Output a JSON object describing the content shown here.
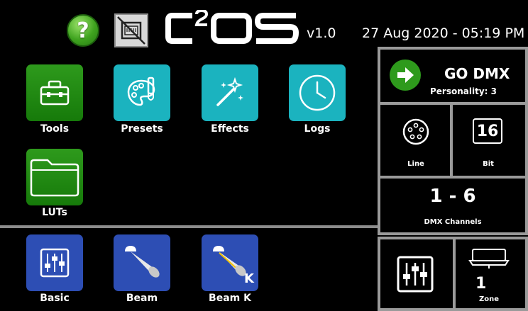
{
  "header": {
    "help_symbol": "?",
    "logo_text": "C2OS",
    "version": "v1.0",
    "datetime": "27 Aug 2020 - 05:19 PM"
  },
  "apps": {
    "tools": "Tools",
    "presets": "Presets",
    "effects": "Effects",
    "logs": "Logs",
    "luts": "LUTs"
  },
  "modes": {
    "basic": "Basic",
    "beam": "Beam",
    "beam_k": "Beam K",
    "beam_k_badge": "K"
  },
  "status": {
    "go_label": "GO DMX",
    "personality": "Personality: 3",
    "line_label": "Line",
    "bit_value": "16",
    "bit_label": "Bit",
    "channels": "1 - 6",
    "channels_label": "DMX Channels",
    "zone_value": "1",
    "zone_label": "Zone"
  },
  "colors": {
    "green": "#2e9a1c",
    "teal": "#1bb3bf",
    "blue": "#2d4eb4",
    "border": "#9a9a9a"
  }
}
